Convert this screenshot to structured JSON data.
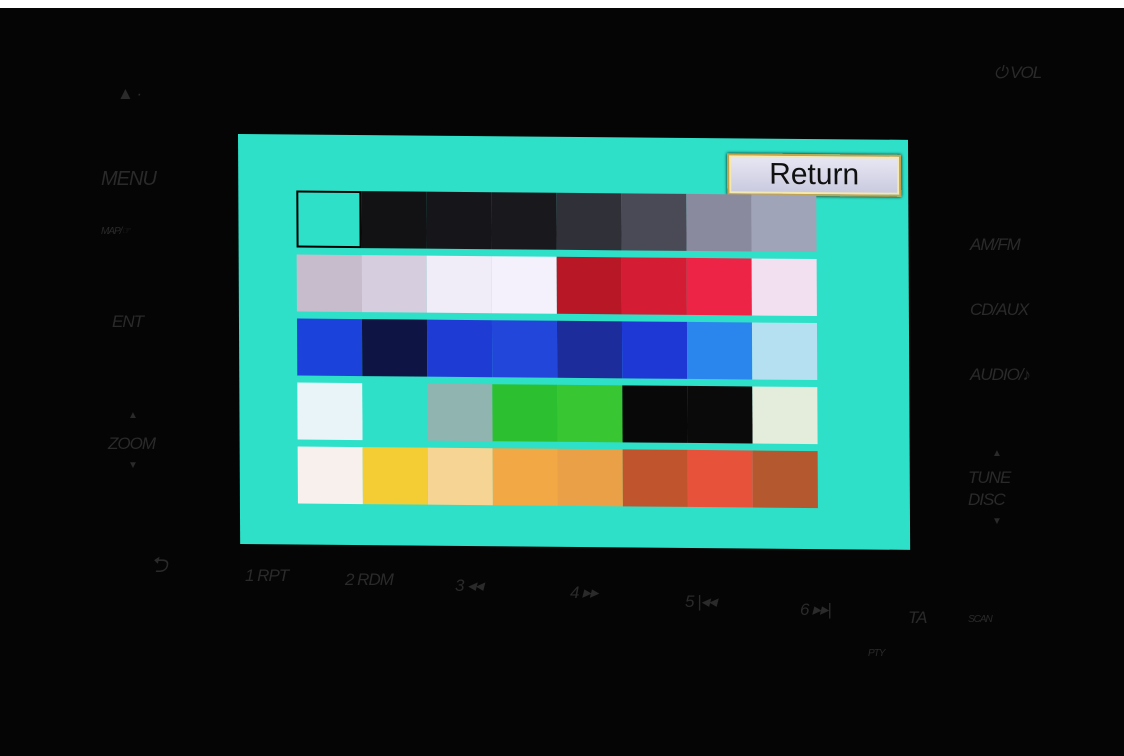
{
  "bezel": {
    "eject": "▲ ·",
    "menu": "MENU",
    "map": "MAP/☞",
    "ent": "ENT",
    "zoom_up": "▲",
    "zoom": "ZOOM",
    "zoom_down": "▼",
    "back": "⮌",
    "vol": "⏻ VOL",
    "am_fm": "AM/FM",
    "cd_aux": "CD/AUX",
    "audio": "AUDIO/♪",
    "tune_up": "▲",
    "tune": "TUNE",
    "disc": "DISC",
    "tune_down": "▼",
    "presets": [
      "1 RPT",
      "2 RDM",
      "3 ◂◂",
      "4 ▸▸",
      "5 |◂◂",
      "6 ▸▸|"
    ],
    "ta": "TA",
    "pty": "PTY",
    "scan": "SCAN"
  },
  "screen": {
    "return_label": "Return",
    "selected_swatch": "1-1",
    "palette": [
      [
        "#2ee0c8",
        "#121214",
        "#16161a",
        "#19191d",
        "#303038",
        "#4a4a56",
        "#8a8a9e",
        "#a0a4b8"
      ],
      [
        "#c6bccc",
        "#d6cede",
        "#f0ecf8",
        "#f4f0fc",
        "#b81826",
        "#d41c34",
        "#ee2446",
        "#f2e0f0"
      ],
      [
        "#1c42dc",
        "#0e1544",
        "#1e3bd4",
        "#2346da",
        "#1c2c9a",
        "#1e38d6",
        "#2a86ec",
        "#b4e0f2"
      ],
      [
        "#e8f4f8",
        "#2ee0c8",
        "#90b4b0",
        "#2cc030",
        "#38c632",
        "#080808",
        "#0a0a0a",
        "#e4ecdc"
      ],
      [
        "#f8f0ec",
        "#f4cc34",
        "#f6d494",
        "#f2a844",
        "#eaa046",
        "#c0542c",
        "#e6523a",
        "#b45830"
      ]
    ]
  }
}
